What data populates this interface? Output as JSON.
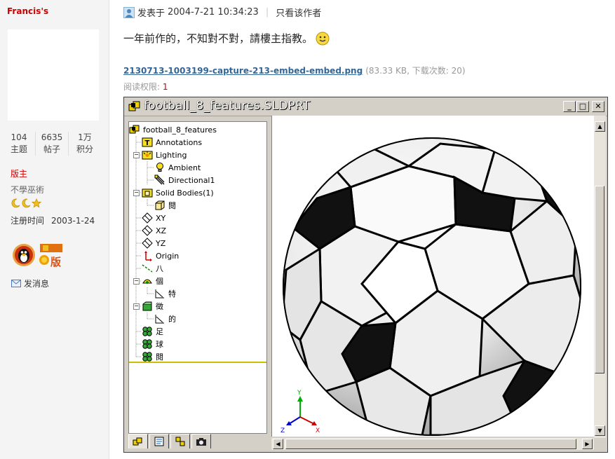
{
  "user": {
    "name": "Francis's",
    "stats": [
      {
        "value": "104",
        "label": "主题"
      },
      {
        "value": "6635",
        "label": "帖子"
      },
      {
        "value": "1万",
        "label": "积分"
      }
    ],
    "role": "版主",
    "title": "不學巫術",
    "reg_label": "注册时间",
    "reg_date": "2003-1-24",
    "send_message": "发消息",
    "badge_text": "版"
  },
  "post": {
    "posted_prefix": "发表于",
    "posted_time": "2004-7-21 10:34:23",
    "only_author": "只看该作者",
    "message": "一年前作的，不知對不對，請樓主指教。",
    "attachment_name": "2130713-1003199-capture-213-embed-embed.png",
    "attachment_info": "(83.33 KB, 下载次数: 20)",
    "permission_label": "阅读权限:",
    "permission_value": "1"
  },
  "solidworks": {
    "window_title": "football_8_features.SLDPRT",
    "buttons": {
      "minimize": "_",
      "maximize": "□",
      "close": "✕"
    },
    "tree": [
      {
        "label": "football_8_features",
        "icon": "part-icon"
      },
      {
        "label": "Annotations",
        "icon": "annotation-icon"
      },
      {
        "label": "Lighting",
        "icon": "lighting-folder-icon"
      },
      {
        "label": "Ambient",
        "icon": "bulb-icon"
      },
      {
        "label": "Directional1",
        "icon": "directional-light-icon"
      },
      {
        "label": "Solid Bodies(1)",
        "icon": "solid-bodies-icon"
      },
      {
        "label": "閱",
        "icon": "body-icon"
      },
      {
        "label": "XY",
        "icon": "plane-icon"
      },
      {
        "label": "XZ",
        "icon": "plane-icon"
      },
      {
        "label": "YZ",
        "icon": "plane-icon"
      },
      {
        "label": "Origin",
        "icon": "origin-icon"
      },
      {
        "label": "八",
        "icon": "axis-icon"
      },
      {
        "label": "個",
        "icon": "feature-icon"
      },
      {
        "label": "特",
        "icon": "sketch-icon"
      },
      {
        "label": "徵",
        "icon": "feature-icon"
      },
      {
        "label": "的",
        "icon": "sketch-icon"
      },
      {
        "label": "足",
        "icon": "pattern-icon"
      },
      {
        "label": "球",
        "icon": "pattern-icon"
      },
      {
        "label": "閱",
        "icon": "pattern-icon"
      }
    ],
    "axes": {
      "x": "X",
      "y": "Y",
      "z": "Z"
    }
  },
  "colors": {
    "accent_red": "#cc0000",
    "link_blue": "#336699",
    "win_gray": "#d4d0c8"
  }
}
